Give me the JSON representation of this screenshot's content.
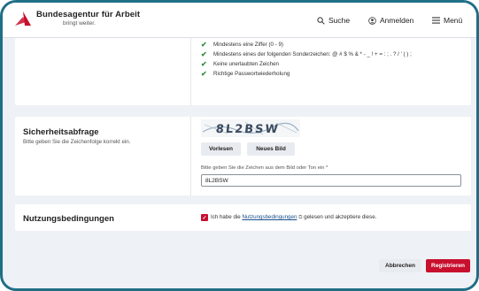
{
  "header": {
    "brand": "Bundesagentur für Arbeit",
    "tagline": "bringt weiter.",
    "search_label": "Suche",
    "login_label": "Anmelden",
    "menu_label": "Menü",
    "icons": {
      "logo": "ba-logo-icon",
      "search": "search-icon",
      "login": "user-icon",
      "menu": "hamburger-icon"
    }
  },
  "password_requirements": [
    "Mindestens eine Ziffer (0 - 9)",
    "Mindestens eines der folgenden Sonderzeichen: @ # $ % & * - _ ! + = : ; . ? / ' ( ) ;",
    "Keine unerlaubten Zeichen",
    "Richtige Passwortwiederholung"
  ],
  "security": {
    "title": "Sicherheitsabfrage",
    "subtitle": "Bitte geben Sie die Zeichenfolge korrekt ein.",
    "captcha_text": "8L2BSW",
    "read_aloud_label": "Vorlesen",
    "new_image_label": "Neues Bild",
    "field_label": "Bitte geben Sie die Zeichen aus dem Bild oder Ton ein *",
    "field_value": "8L2BSW"
  },
  "terms": {
    "title": "Nutzungsbedingungen",
    "text_before": "Ich habe die",
    "link_text": "Nutzungsbedingungen",
    "text_after": "gelesen und akzeptiere diese.",
    "checked": true
  },
  "actions": {
    "cancel_label": "Abbrechen",
    "register_label": "Registrieren"
  },
  "colors": {
    "accent_red": "#c8102e",
    "check_green": "#2f8f3a",
    "frame_border": "#1f6f85",
    "page_bg": "#eef1f5"
  }
}
